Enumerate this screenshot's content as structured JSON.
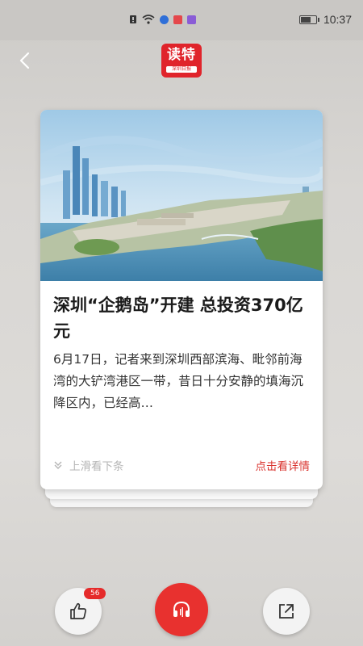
{
  "status_bar": {
    "time": "10:37",
    "icons": [
      "notification-icon",
      "wifi-icon",
      "app-icon-blue",
      "app-icon-red",
      "app-icon-purple",
      "battery-icon"
    ]
  },
  "nav": {
    "back_icon": "chevron-left-icon",
    "logo": {
      "main": "读特",
      "sub": "深圳日报"
    }
  },
  "card": {
    "image_desc": "aerial-city-render",
    "title": "深圳“企鹅岛”开建 总投资370亿元",
    "summary": "6月17日，记者来到深圳西部滨海、毗邻前海湾的大铲湾港区一带，昔日十分安静的填海沉降区内，已经高…",
    "swipe_hint": "上滑看下条",
    "detail_link": "点击看详情"
  },
  "actions": {
    "like_count": "56",
    "like_icon": "thumbs-up-icon",
    "audio_icon": "headphones-icon",
    "share_icon": "share-icon"
  },
  "colors": {
    "accent": "#e0242b",
    "detail": "#d9322c"
  }
}
